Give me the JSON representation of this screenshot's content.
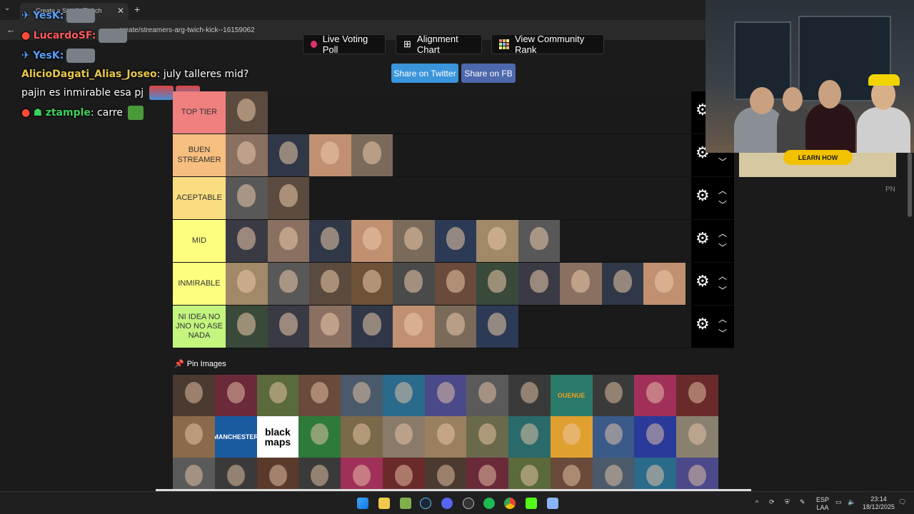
{
  "browser": {
    "tab_title": "Create a St…G (Twitch",
    "url": "create/streamers-arg-twich-kick--16159062"
  },
  "chat": [
    {
      "user": "YesK:",
      "color": "#5aa0ff",
      "text": ""
    },
    {
      "user": "LucardoSF:",
      "color": "#ff5a5a",
      "text": ""
    },
    {
      "user": "YesK:",
      "color": "#5aa0ff",
      "text": ""
    },
    {
      "user": "AlicioDagati_Alias_Joseo",
      "color": "#e8c84a",
      "text": ": july talleres mid?"
    },
    {
      "user": "",
      "color": "#ffffff",
      "text": "pajin es inmirable esa pj"
    },
    {
      "user": "ztample",
      "color": "#3ad15a",
      "text": ": carre"
    }
  ],
  "toolbar": {
    "live_voting": "Live Voting Poll",
    "alignment": "Alignment Chart",
    "community": "View Community Rank",
    "share_twitter": "Share on Twitter",
    "share_fb": "Share on FB"
  },
  "tiers": [
    {
      "label": "TOP TIER",
      "color": "#f07f80",
      "count": 1
    },
    {
      "label": "BUEN STREAMER",
      "color": "#f6be7f",
      "count": 4
    },
    {
      "label": "ACEPTABLE",
      "color": "#f9dd80",
      "count": 2
    },
    {
      "label": "MID",
      "color": "#fdfe7f",
      "count": 8
    },
    {
      "label": "INMIRABLE",
      "color": "#fdfe7f",
      "count": 11
    },
    {
      "label": "NI IDEA NO JNO NO ASE NADA",
      "color": "#c3f57f",
      "count": 7
    }
  ],
  "pin": {
    "title": "Pin Images",
    "rows": [
      13,
      13,
      13
    ],
    "logos": {
      "1-10": "OUENUE",
      "2-2": "MANCHESTER",
      "2-3": "black\nmaps"
    }
  },
  "ad": {
    "button": "LEARN HOW",
    "tag": "PN"
  },
  "taskbar": {
    "lang": "ESP",
    "lang2": "LAA",
    "time": "23:14",
    "date": "18/12/2025"
  },
  "colors": {
    "accent_blue": "#3b95db",
    "fb_blue": "#4e68ad"
  }
}
